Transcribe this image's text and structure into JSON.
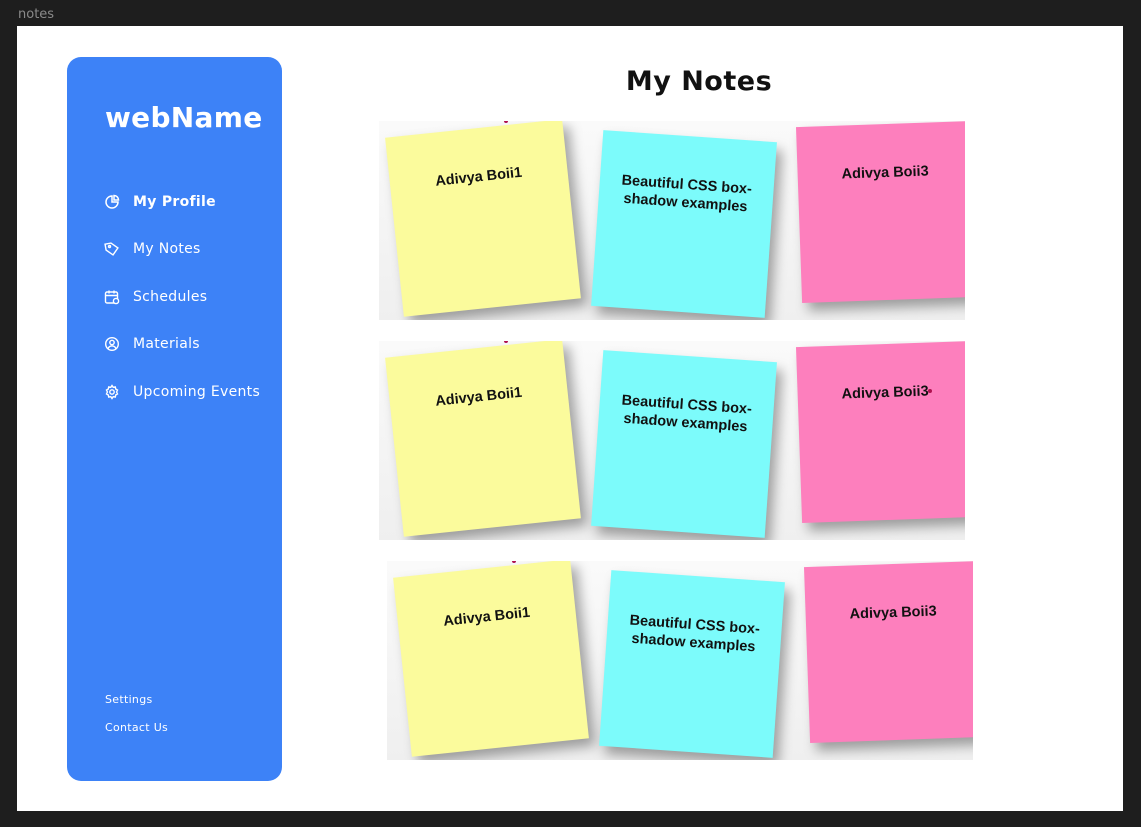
{
  "window": {
    "title": "notes"
  },
  "sidebar": {
    "brand": "webName",
    "items": [
      {
        "label": "My Profile",
        "icon": "pie-chart-icon",
        "active": true
      },
      {
        "label": "My Notes",
        "icon": "tag-icon",
        "active": false
      },
      {
        "label": "Schedules",
        "icon": "calendar-icon",
        "active": false
      },
      {
        "label": "Materials",
        "icon": "user-circle-icon",
        "active": false
      },
      {
        "label": "Upcoming Events",
        "icon": "gear-icon",
        "active": false
      }
    ],
    "footer": [
      {
        "label": "Settings"
      },
      {
        "label": "Contact Us"
      }
    ]
  },
  "main": {
    "title": "My Notes",
    "rows": [
      {
        "notes": [
          {
            "text": "Adivya Boii1",
            "color": "#fbfb9c"
          },
          {
            "text": "Beautiful CSS box-shadow examples",
            "color": "#7cfbfb"
          },
          {
            "text": "Adivya Boii3",
            "color": "#fd7fbd"
          }
        ]
      },
      {
        "notes": [
          {
            "text": "Adivya Boii1",
            "color": "#fbfb9c"
          },
          {
            "text": "Beautiful CSS box-shadow examples",
            "color": "#7cfbfb"
          },
          {
            "text": "Adivya Boii3",
            "color": "#fd7fbd"
          }
        ]
      },
      {
        "notes": [
          {
            "text": "Adivya Boii1",
            "color": "#fbfb9c"
          },
          {
            "text": "Beautiful CSS box-shadow examples",
            "color": "#7cfbfb"
          },
          {
            "text": "Adivya Boii3",
            "color": "#fd7fbd"
          }
        ]
      }
    ]
  },
  "colors": {
    "sidebar": "#3d82f7",
    "background": "#1e1e1e",
    "canvas": "#ffffff"
  }
}
